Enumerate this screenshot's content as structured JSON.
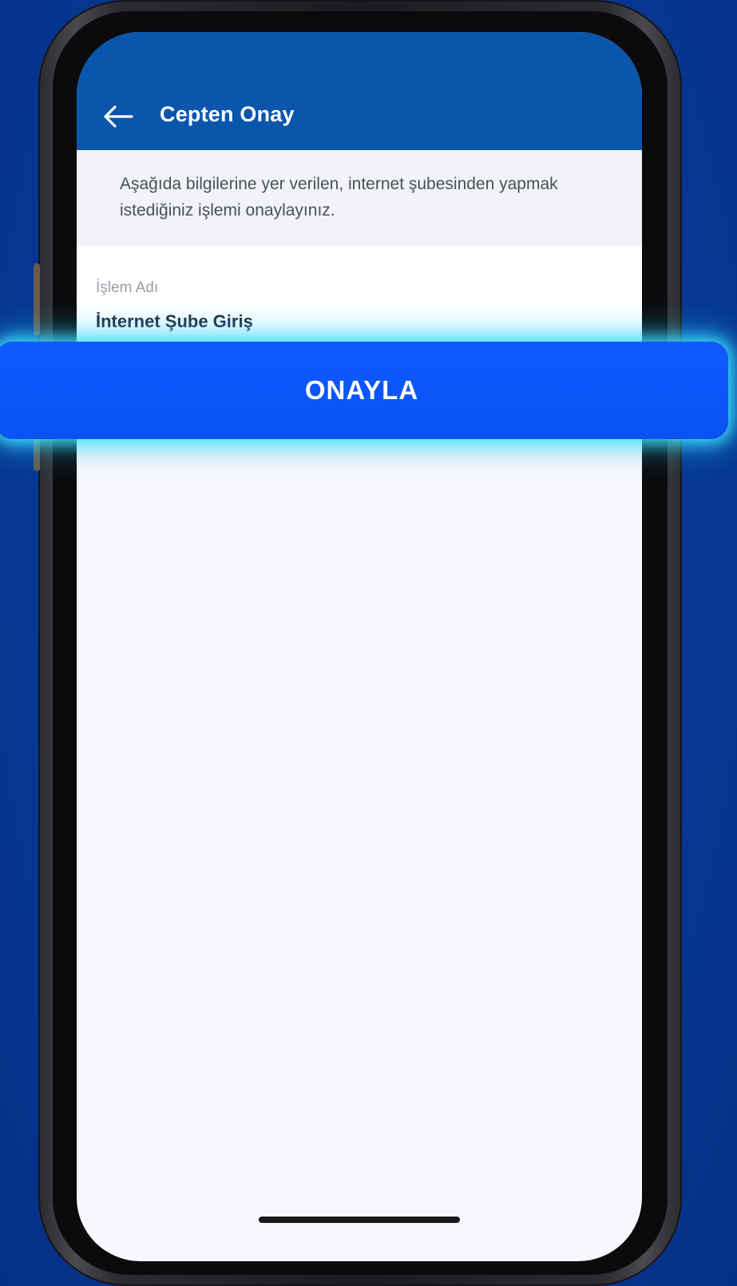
{
  "app": {
    "title": "Cepten Onay"
  },
  "colors": {
    "header_bg": "#0a56ad",
    "button_bg": "#0f5bff",
    "button_glow": "#40e6ff",
    "page_bg": "#073c9a"
  },
  "icons": {
    "back": "arrow-left-icon"
  },
  "info": {
    "text": "Aşağıda bilgilerine yer verilen, internet şubesinden yapmak istediğiniz işlemi onaylayınız."
  },
  "field": {
    "label": "İşlem Adı",
    "value": "İnternet Şube Giriş"
  },
  "actions": {
    "confirm_label": "ONAYLA"
  }
}
